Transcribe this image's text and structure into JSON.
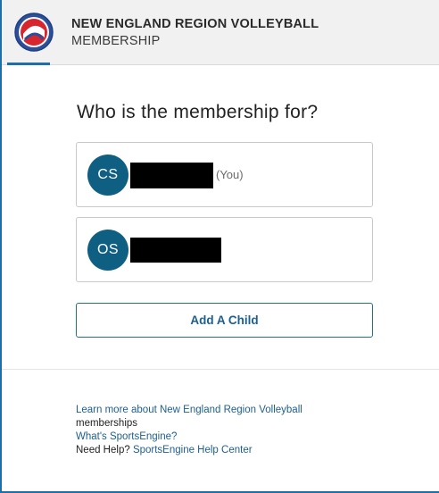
{
  "header": {
    "org_name": "NEW ENGLAND REGION VOLLEYBALL",
    "section": "MEMBERSHIP",
    "logo_icon": "volleyball-association-logo-icon"
  },
  "main": {
    "question": "Who is the membership for?",
    "people": [
      {
        "initials": "CS",
        "tag": "(You)"
      },
      {
        "initials": "OS",
        "tag": ""
      }
    ],
    "add_child_label": "Add A Child"
  },
  "footer": {
    "learn_more_link": "Learn more about New England Region Volleyball",
    "learn_more_suffix": "memberships",
    "whats_link": "What's SportsEngine?",
    "need_help_label": "Need Help?",
    "help_center_link": "SportsEngine Help Center"
  },
  "colors": {
    "accent": "#1d6fa8",
    "avatar": "#0f5f83",
    "link": "#1d5f8e"
  }
}
